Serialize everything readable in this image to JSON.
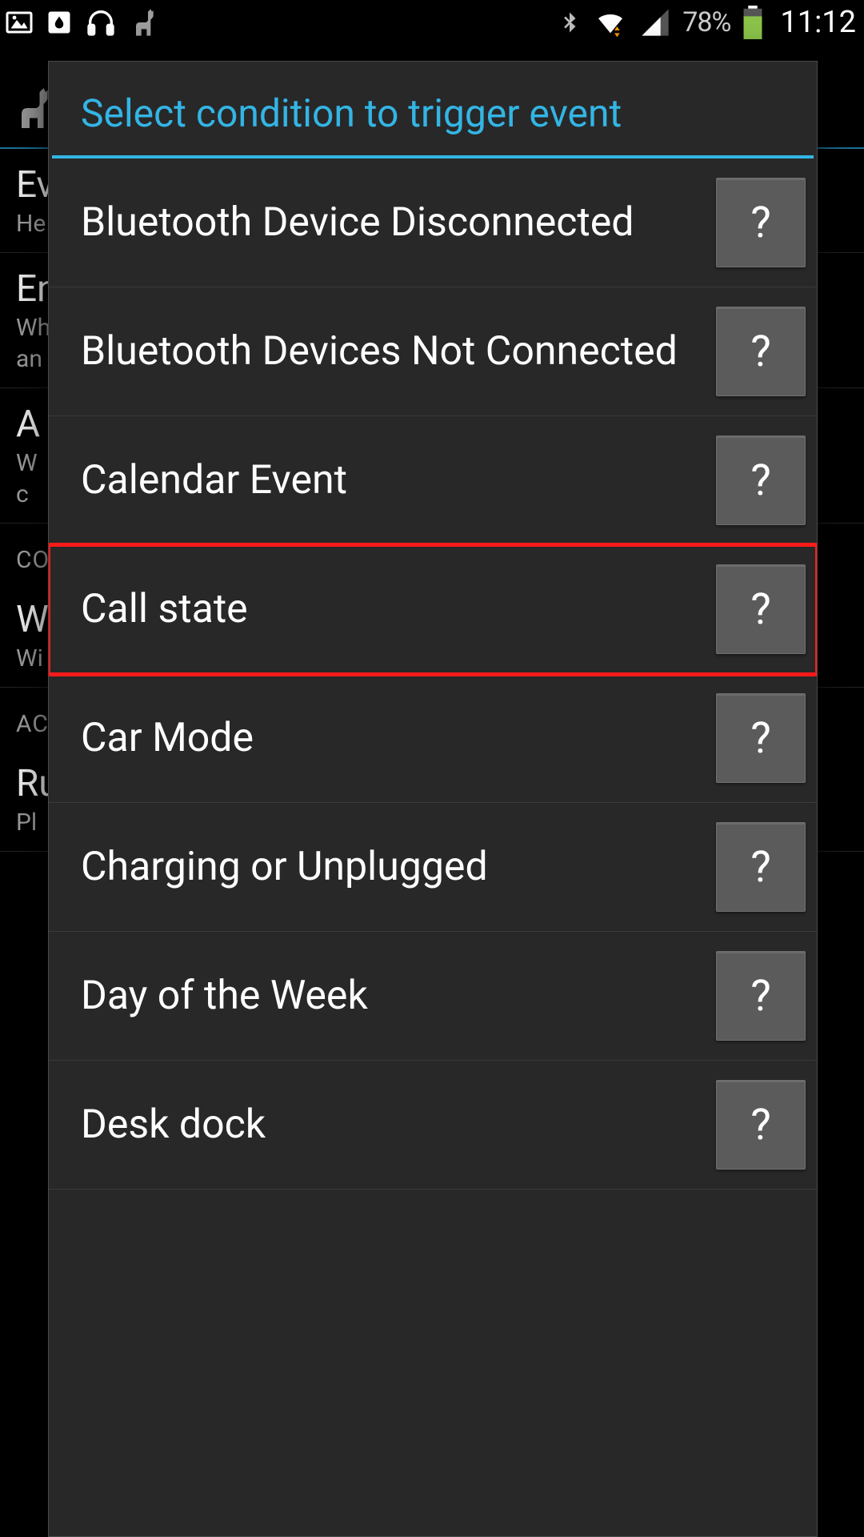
{
  "status_bar": {
    "battery_pct": "78%",
    "clock": "11:12"
  },
  "background": {
    "row1_title": "Ev",
    "row1_sub": "He",
    "row2_title": "En",
    "row2_sub_a": "Wh",
    "row2_sub_b": "an",
    "row3_title": "A",
    "row3_sub_a": "W",
    "row3_sub_b": "c",
    "section1": "CO",
    "row4_title": "Wi",
    "row4_sub": "Wi",
    "section2": "AC",
    "row5_title": "Ru",
    "row5_sub": "Pl"
  },
  "dialog": {
    "title": "Select condition to trigger event",
    "help_label": "?",
    "conditions": [
      {
        "label": "Bluetooth Device Disconnected",
        "highlight": false
      },
      {
        "label": "Bluetooth Devices Not Connected",
        "highlight": false
      },
      {
        "label": "Calendar Event",
        "highlight": false
      },
      {
        "label": "Call state",
        "highlight": true
      },
      {
        "label": "Car Mode",
        "highlight": false
      },
      {
        "label": "Charging or Unplugged",
        "highlight": false
      },
      {
        "label": "Day of the Week",
        "highlight": false
      },
      {
        "label": "Desk dock",
        "highlight": false
      }
    ]
  }
}
